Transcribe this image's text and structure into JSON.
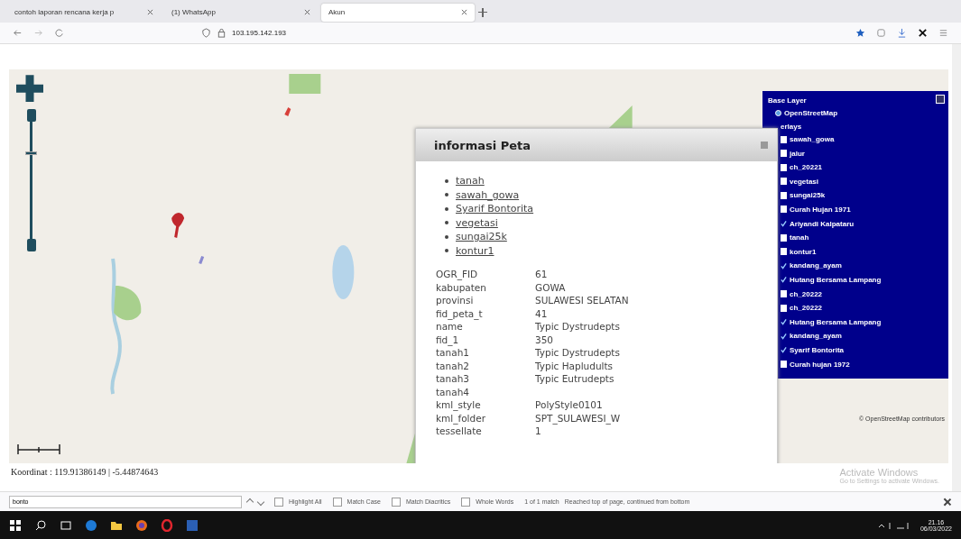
{
  "browser": {
    "tabs": [
      {
        "title": "contoh laporan rencana kerja p",
        "selected": false
      },
      {
        "title": "(1) WhatsApp",
        "selected": false
      },
      {
        "title": "Akun",
        "selected": true
      }
    ],
    "address": "103.195.142.193"
  },
  "map": {
    "zoom": {
      "level": 0.73
    },
    "attribution": "© OpenStreetMap contributors",
    "layer_switcher": {
      "base_title": "Base Layer",
      "overlays_title": "erlays",
      "items": [
        {
          "kind": "radio",
          "label": "OpenStreetMap",
          "checked": true
        },
        {
          "kind": "checkbox",
          "label": "sawah_gowa",
          "checked": false
        },
        {
          "kind": "checkbox",
          "label": "jalur",
          "checked": false
        },
        {
          "kind": "checkbox",
          "label": "ch_20221",
          "checked": false
        },
        {
          "kind": "checkbox",
          "label": "vegetasi",
          "checked": false
        },
        {
          "kind": "checkbox",
          "label": "sungai25k",
          "checked": false
        },
        {
          "kind": "checkbox",
          "label": "Curah Hujan 1971",
          "checked": false
        },
        {
          "kind": "checkbox",
          "label": "Ariyandi Kalpataru",
          "checked": true
        },
        {
          "kind": "checkbox",
          "label": "tanah",
          "checked": false
        },
        {
          "kind": "checkbox",
          "label": "kontur1",
          "checked": false
        },
        {
          "kind": "checkbox",
          "label": "kandang_ayam",
          "checked": true
        },
        {
          "kind": "checkbox",
          "label": "Hutang Bersama Lampang",
          "checked": true
        },
        {
          "kind": "checkbox",
          "label": "ch_20222",
          "checked": false
        },
        {
          "kind": "checkbox",
          "label": "ch_20222",
          "checked": false
        },
        {
          "kind": "checkbox",
          "label": "Hutang Bersama Lampang",
          "checked": true
        },
        {
          "kind": "checkbox",
          "label": "kandang_ayam",
          "checked": true
        },
        {
          "kind": "checkbox",
          "label": "Syarif Bontorita",
          "checked": true
        },
        {
          "kind": "checkbox",
          "label": "Curah hujan 1972",
          "checked": false
        }
      ]
    },
    "popup": {
      "title": "informasi Peta",
      "links": [
        "tanah",
        "sawah_gowa",
        "Syarif Bontorita",
        "vegetasi",
        "sungai25k",
        "kontur1"
      ],
      "attributes": [
        {
          "key": "OGR_FID",
          "value": "61"
        },
        {
          "key": "kabupaten",
          "value": "GOWA"
        },
        {
          "key": "provinsi",
          "value": "SULAWESI SELATAN"
        },
        {
          "key": "fid_peta_t",
          "value": "41"
        },
        {
          "key": "name",
          "value": "Typic Dystrudepts"
        },
        {
          "key": "fid_1",
          "value": "350"
        },
        {
          "key": "tanah1",
          "value": "Typic Dystrudepts"
        },
        {
          "key": "tanah2",
          "value": "Typic Hapludults"
        },
        {
          "key": "tanah3",
          "value": "Typic Eutrudepts"
        },
        {
          "key": "tanah4"
        },
        {
          "key": "kml_style",
          "value": "PolyStyle0101"
        },
        {
          "key": "kml_folder",
          "value": "SPT_SULAWESI_W"
        },
        {
          "key": "tessellate",
          "value": "1"
        }
      ]
    }
  },
  "coordinates": "Koordinat : 119.91386149 | -5.44874643",
  "activation": {
    "title": "Activate Windows",
    "subtitle": "Go to Settings to activate Windows."
  },
  "find_bar": {
    "query": "bonto",
    "options": [
      {
        "label": "Highlight All",
        "checked": false
      },
      {
        "label": "Match Case",
        "checked": false
      },
      {
        "label": "Match Diacritics",
        "checked": false
      },
      {
        "label": "Whole Words",
        "checked": false
      }
    ],
    "count": "1 of 1 match",
    "message": "Reached top of page, continued from bottom"
  },
  "taskbar": {
    "time": "21.16",
    "date": "06/03/2022"
  }
}
